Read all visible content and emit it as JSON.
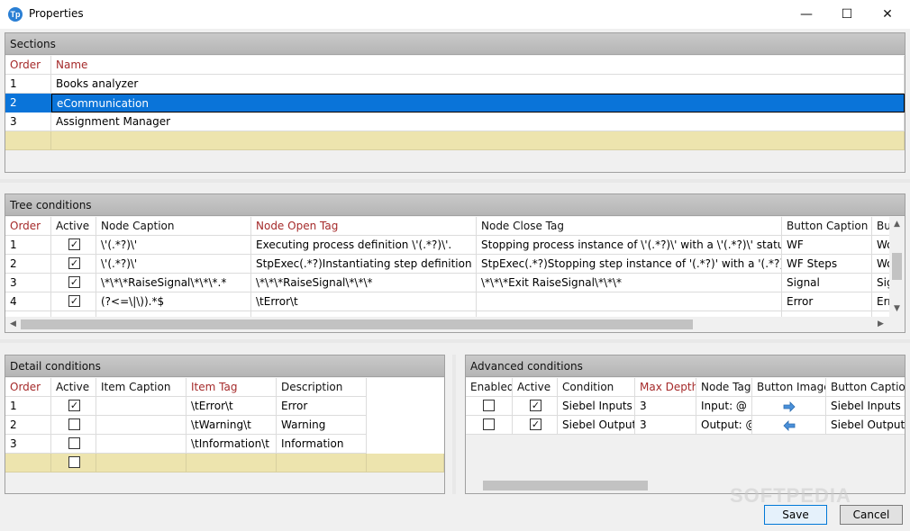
{
  "window": {
    "title": "Properties",
    "icon_label": "Tp",
    "minimize": "—",
    "maximize": "☐",
    "close": "✕"
  },
  "sections": {
    "header": "Sections",
    "columns": [
      "Order",
      "Name"
    ],
    "rows": [
      {
        "order": "1",
        "name": "Books analyzer"
      },
      {
        "order": "2",
        "name": "eCommunication"
      },
      {
        "order": "3",
        "name": "Assignment Manager"
      }
    ]
  },
  "tree": {
    "header": "Tree conditions",
    "columns": [
      "Order",
      "Active",
      "Node Caption",
      "Node Open Tag",
      "Node Close Tag",
      "Button Caption",
      "Bu"
    ],
    "rows": [
      {
        "order": "1",
        "active": true,
        "caption": "\\'(.*?)\\'",
        "open": "Executing process definition \\'(.*?)\\'.",
        "close": "Stopping process instance of \\'(.*?)\\' with a \\'(.*?)\\' status",
        "button": "WF",
        "bu": "Wo"
      },
      {
        "order": "2",
        "active": true,
        "caption": "\\'(.*?)\\'",
        "open": "StpExec(.*?)Instantiating step definition '(.*?)'.",
        "close": "StpExec(.*?)Stopping step instance of '(.*?)' with a '(.*?)' status.",
        "button": "WF Steps",
        "bu": "Wo"
      },
      {
        "order": "3",
        "active": true,
        "caption": "\\*\\*\\*RaiseSignal\\*\\*\\*.*",
        "open": "\\*\\*\\*RaiseSignal\\*\\*\\*",
        "close": "\\*\\*\\*Exit RaiseSignal\\*\\*\\*",
        "button": "Signal",
        "bu": "Sig"
      },
      {
        "order": "4",
        "active": true,
        "caption": "(?<=\\|\\)).*$",
        "open": "\\tError\\t",
        "close": "",
        "button": "Error",
        "bu": "Err"
      }
    ]
  },
  "detail": {
    "header": "Detail conditions",
    "columns": [
      "Order",
      "Active",
      "Item Caption",
      "Item Tag",
      "Description"
    ],
    "rows": [
      {
        "order": "1",
        "active": true,
        "caption": "",
        "tag": "\\tError\\t",
        "desc": "Error"
      },
      {
        "order": "2",
        "active": false,
        "caption": "",
        "tag": "\\tWarning\\t",
        "desc": "Warning"
      },
      {
        "order": "3",
        "active": false,
        "caption": "",
        "tag": "\\tInformation\\t",
        "desc": "Information"
      }
    ]
  },
  "advanced": {
    "header": "Advanced conditions",
    "columns": [
      "Enabled",
      "Active",
      "Condition",
      "Max Depth",
      "Node Tag",
      "Button Image",
      "Button Caption"
    ],
    "rows": [
      {
        "enabled": false,
        "active": true,
        "condition": "Siebel Inputs",
        "depth": "3",
        "tag": "Input: @",
        "image": "arrow-right-icon",
        "caption": "Siebel Inputs"
      },
      {
        "enabled": false,
        "active": true,
        "condition": "Siebel Outputs",
        "depth": "3",
        "tag": "Output: @",
        "image": "arrow-left-icon",
        "caption": "Siebel Outputs"
      }
    ]
  },
  "buttons": {
    "save": "Save",
    "cancel": "Cancel"
  },
  "watermark": "SOFTPEDIA",
  "colors": {
    "selection": "#0a74d9",
    "new_row": "#ede4ae",
    "required_header": "#a52a2a",
    "image_arrow": "#4a90d9"
  }
}
